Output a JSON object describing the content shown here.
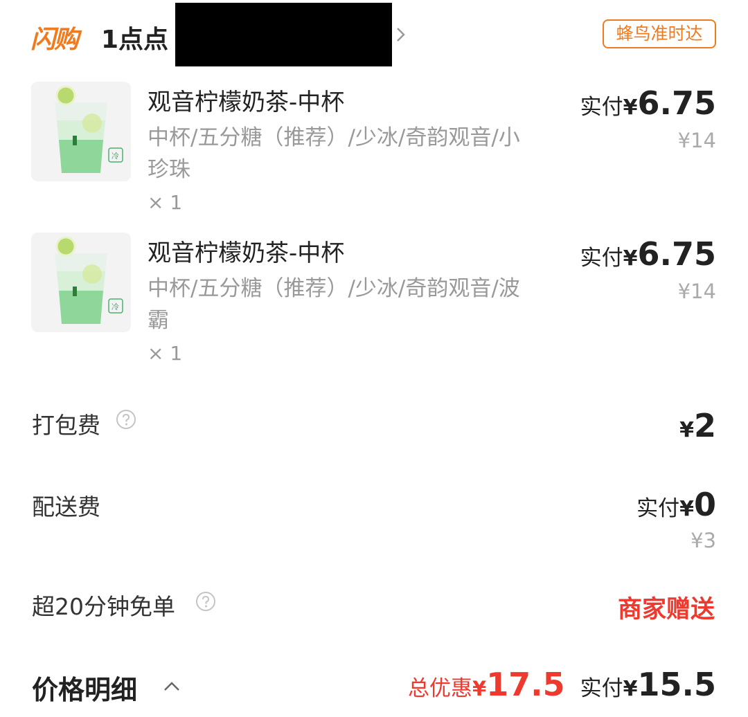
{
  "header": {
    "brand": "闪购",
    "shop_name": "1点点",
    "delivery_tag": "蜂鸟准时达"
  },
  "items": [
    {
      "name": "观音柠檬奶茶-中杯",
      "spec": "中杯/五分糖（推荐）/少冰/奇韵观音/小珍珠",
      "qty": "× 1",
      "pay_label": "实付",
      "currency": "¥",
      "pay_amount": "6.75",
      "original_price": "¥14",
      "thumb_badge": "冷"
    },
    {
      "name": "观音柠檬奶茶-中杯",
      "spec": "中杯/五分糖（推荐）/少冰/奇韵观音/波霸",
      "qty": "× 1",
      "pay_label": "实付",
      "currency": "¥",
      "pay_amount": "6.75",
      "original_price": "¥14",
      "thumb_badge": "冷"
    }
  ],
  "fees": {
    "packing": {
      "label": "打包费",
      "currency": "¥",
      "amount": "2"
    },
    "delivery": {
      "label": "配送费",
      "pay_label": "实付",
      "currency": "¥",
      "amount": "0",
      "original_price": "¥3"
    },
    "late_free": {
      "label": "超20分钟免单",
      "value": "商家赠送"
    }
  },
  "summary": {
    "label": "价格明细",
    "discount_label": "总优惠",
    "discount_currency": "¥",
    "discount_amount": "17.5",
    "pay_label": "实付",
    "pay_currency": "¥",
    "pay_amount": "15.5"
  },
  "colors": {
    "brand_orange": "#f07a1e",
    "discount_red": "#ee3a2e",
    "muted_gray": "#999999"
  }
}
